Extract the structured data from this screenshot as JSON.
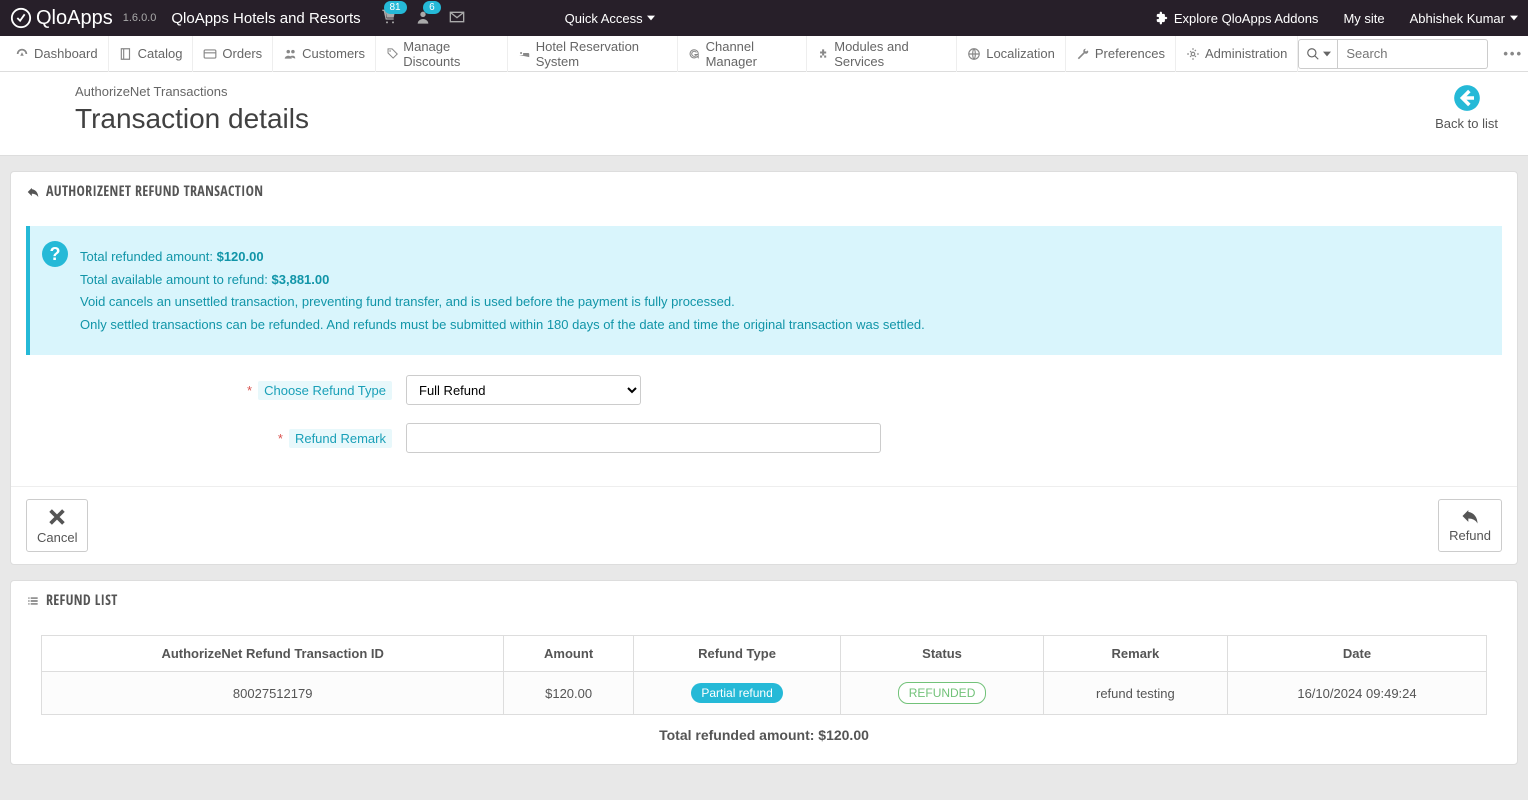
{
  "topbar": {
    "app_name": "QloApps",
    "version": "1.6.0.0",
    "hotel_name": "QloApps Hotels and Resorts",
    "cart_badge": "81",
    "user_badge": "6",
    "quick_access": "Quick Access",
    "explore": "Explore QloApps Addons",
    "mysite": "My site",
    "username": "Abhishek Kumar"
  },
  "menu": {
    "dashboard": "Dashboard",
    "catalog": "Catalog",
    "orders": "Orders",
    "customers": "Customers",
    "discounts": "Manage Discounts",
    "hotel": "Hotel Reservation System",
    "channel": "Channel Manager",
    "modules": "Modules and Services",
    "localization": "Localization",
    "preferences": "Preferences",
    "admin": "Administration",
    "search_placeholder": "Search"
  },
  "header": {
    "breadcrumb": "AuthorizeNet Transactions",
    "title": "Transaction details",
    "back": "Back to list"
  },
  "panel1": {
    "title": "AUTHORIZENET REFUND TRANSACTION",
    "info_l1a": "Total refunded amount: ",
    "info_l1b": "$120.00",
    "info_l2a": "Total available amount to refund: ",
    "info_l2b": "$3,881.00",
    "info_l3": "Void cancels an unsettled transaction, preventing fund transfer, and is used before the payment is fully processed.",
    "info_l4": "Only settled transactions can be refunded. And refunds must be submitted within 180 days of the date and time the original transaction was settled.",
    "label_refund_type": "Choose Refund Type",
    "select_value": "Full Refund",
    "label_remark": "Refund Remark",
    "cancel": "Cancel",
    "refund": "Refund"
  },
  "panel2": {
    "title": "REFUND LIST",
    "th1": "AuthorizeNet Refund Transaction ID",
    "th2": "Amount",
    "th3": "Refund Type",
    "th4": "Status",
    "th5": "Remark",
    "th6": "Date",
    "row": {
      "id": "80027512179",
      "amount": "$120.00",
      "type": "Partial refund",
      "status": "REFUNDED",
      "remark": "refund testing",
      "date": "16/10/2024 09:49:24"
    },
    "summary": "Total refunded amount: $120.00"
  }
}
